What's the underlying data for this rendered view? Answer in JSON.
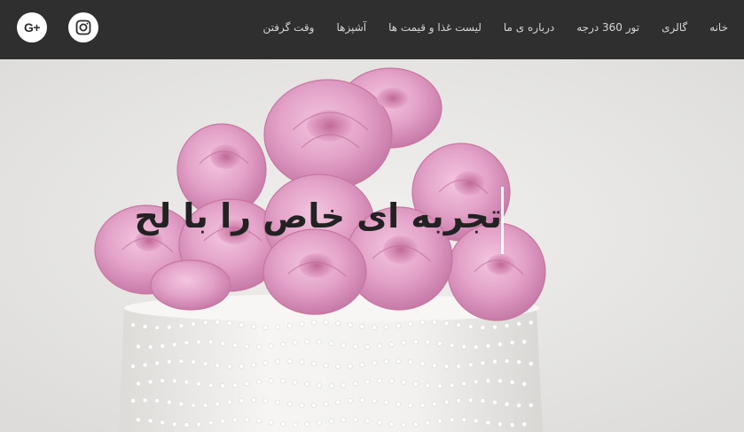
{
  "nav": {
    "items": [
      {
        "id": "home",
        "label": "خانه"
      },
      {
        "id": "gallery",
        "label": "گالری"
      },
      {
        "id": "tour",
        "label": "تور 360 درجه"
      },
      {
        "id": "about",
        "label": "درباره ی ما"
      },
      {
        "id": "menu",
        "label": "لیست غذا و قیمت ها"
      },
      {
        "id": "chefs",
        "label": "آشپزها"
      },
      {
        "id": "reserve",
        "label": "وقت گرفتن"
      }
    ],
    "social": [
      {
        "icon": "google-plus-icon",
        "glyph": "G+"
      },
      {
        "icon": "instagram-icon"
      }
    ]
  },
  "hero": {
    "title": "تجربه ای خاص را با لح",
    "image": "pink-roses-on-white-cake"
  },
  "colors": {
    "navbar_bg": "#2f2f2f",
    "nav_text": "#d6d6d6",
    "rose_pink": "#e4a3c9",
    "cake_white": "#f4f3f1"
  }
}
